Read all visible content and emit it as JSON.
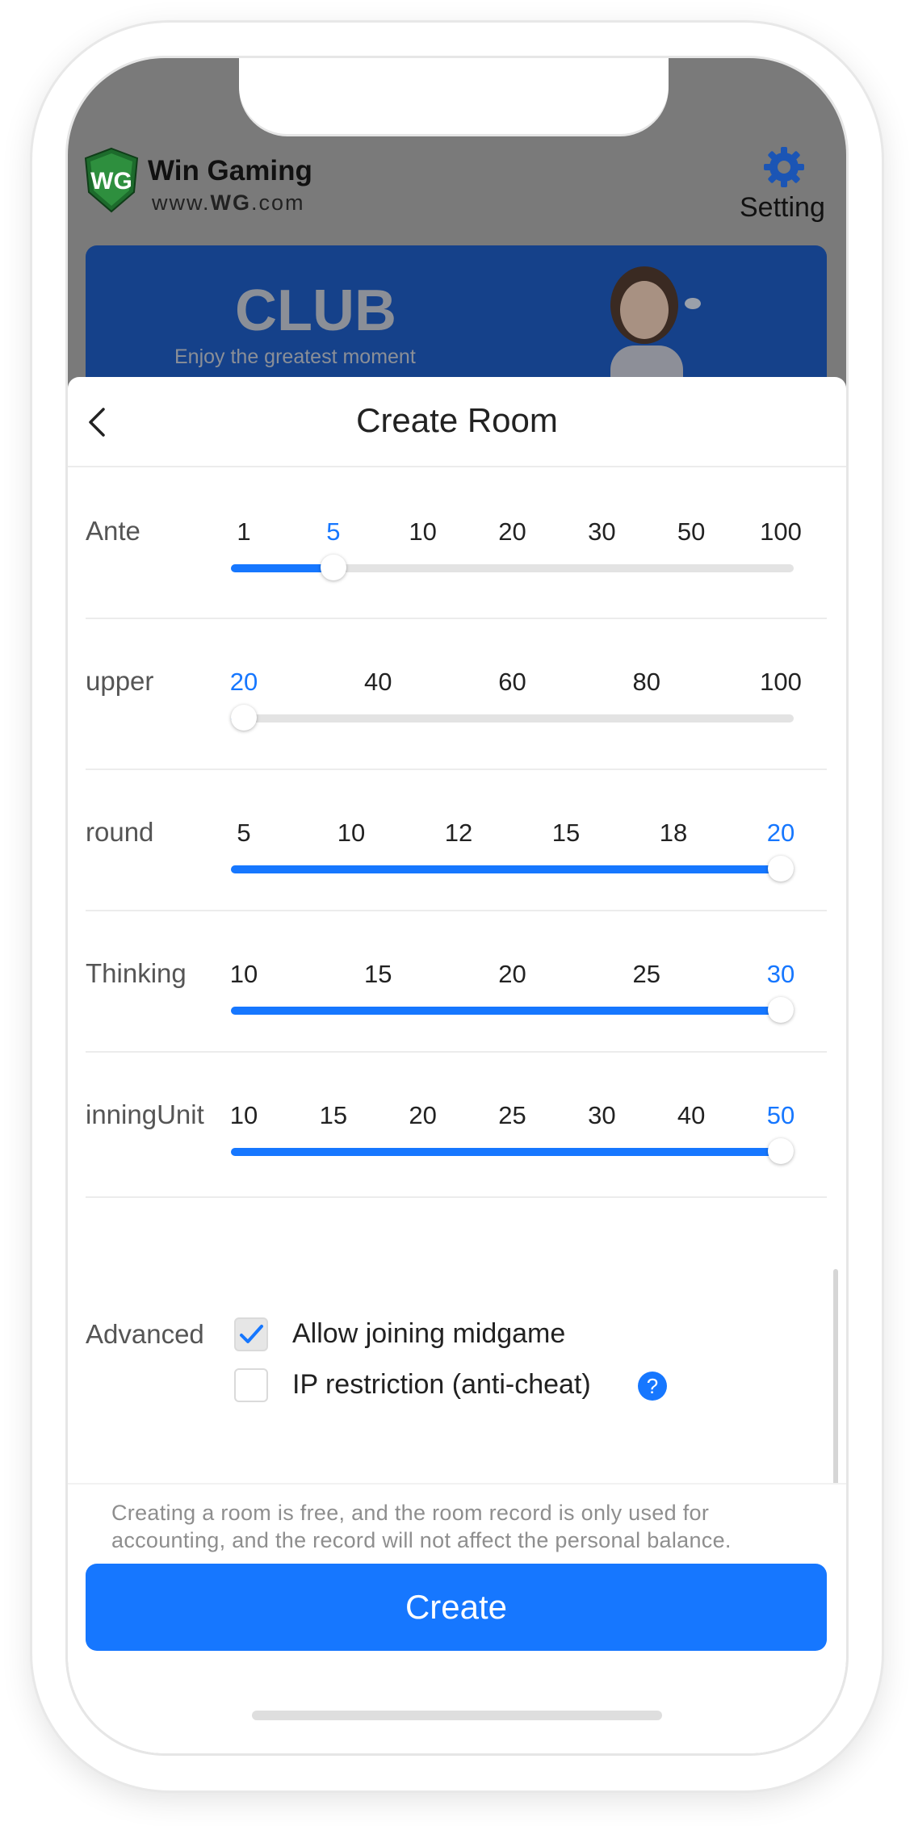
{
  "header": {
    "brand_name": "Win Gaming",
    "brand_url_prefix": "www.",
    "brand_url_bold": "WG",
    "brand_url_suffix": ".com",
    "logo_text": "WG",
    "setting_label": "Setting"
  },
  "banner": {
    "title": "CLUB",
    "subtitle": "Enjoy the greatest moment"
  },
  "sheet": {
    "title": "Create Room"
  },
  "sliders": [
    {
      "label": "Ante",
      "ticks": [
        "1",
        "5",
        "10",
        "20",
        "30",
        "50",
        "100"
      ],
      "selected": "5"
    },
    {
      "label": "upper",
      "ticks": [
        "20",
        "40",
        "60",
        "80",
        "100"
      ],
      "selected": "20"
    },
    {
      "label": "round",
      "ticks": [
        "5",
        "10",
        "12",
        "15",
        "18",
        "20"
      ],
      "selected": "20"
    },
    {
      "label": "Thinking",
      "ticks": [
        "10",
        "15",
        "20",
        "25",
        "30"
      ],
      "selected": "30"
    },
    {
      "label": "inningUnit",
      "ticks": [
        "10",
        "15",
        "20",
        "25",
        "30",
        "40",
        "50"
      ],
      "selected": "50"
    }
  ],
  "advanced": {
    "label": "Advanced",
    "options": [
      {
        "label": "Allow joining midgame",
        "checked": true
      },
      {
        "label": "IP restriction (anti-cheat)",
        "checked": false,
        "help": "?"
      }
    ]
  },
  "footer": {
    "notice": "Creating a room is free, and the room record is only used for accounting, and the record will not affect the personal balance.",
    "create_label": "Create"
  },
  "colors": {
    "accent": "#1677ff",
    "banner_bg": "#15418a",
    "overlay": "#7a7a7a"
  },
  "icons": [
    "back-icon",
    "gear-icon",
    "check-icon",
    "help-icon"
  ]
}
